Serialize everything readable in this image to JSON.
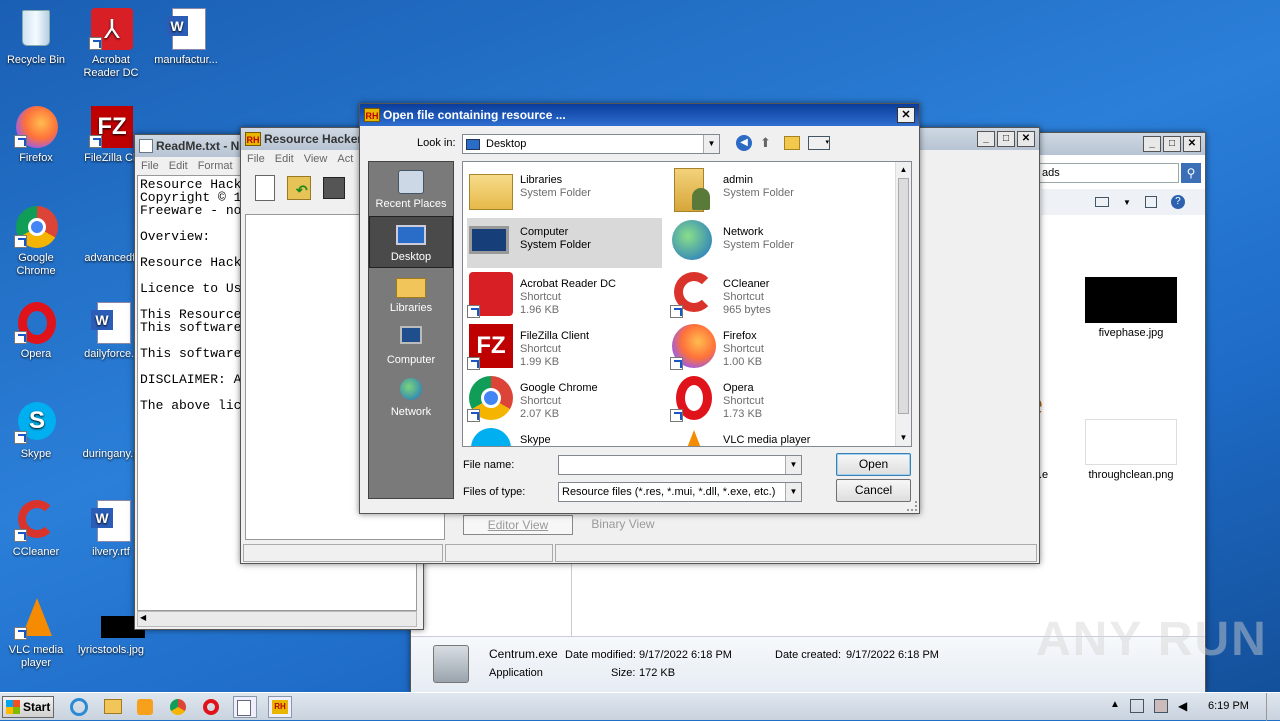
{
  "desktop_icons": [
    {
      "name": "recycle-bin",
      "label": "Recycle Bin"
    },
    {
      "name": "acrobat",
      "label": "Acrobat Reader DC"
    },
    {
      "name": "manufactur",
      "label": "manufactur..."
    },
    {
      "name": "firefox",
      "label": "Firefox"
    },
    {
      "name": "filezilla",
      "label": "FileZilla Cli"
    },
    {
      "name": "chrome",
      "label": "Google Chrome"
    },
    {
      "name": "advancedf",
      "label": "advancedfi"
    },
    {
      "name": "opera",
      "label": "Opera"
    },
    {
      "name": "dailyforce",
      "label": "dailyforce.r"
    },
    {
      "name": "skype",
      "label": "Skype"
    },
    {
      "name": "duringany",
      "label": "duringany.p"
    },
    {
      "name": "ccleaner",
      "label": "CCleaner"
    },
    {
      "name": "ilvery",
      "label": "ilvery.rtf"
    },
    {
      "name": "vlc",
      "label": "VLC media player"
    },
    {
      "name": "lyricstools",
      "label": "lyricstools.jpg"
    }
  ],
  "notepad": {
    "title": "ReadMe.txt - N",
    "menu": [
      "File",
      "Edit",
      "Format"
    ],
    "lines": [
      "Resource Hack",
      "Copyright © 1",
      "Freeware - no",
      "",
      "Overview:",
      "",
      "Resource Hack",
      "",
      "Licence to Us",
      "",
      "This Resource",
      "This software",
      "",
      "This software",
      "",
      "DISCLAIMER: A",
      "",
      "The above lic"
    ]
  },
  "rh": {
    "title": "Resource Hacker",
    "menu": [
      "File",
      "Edit",
      "View",
      "Act"
    ],
    "tab_editor": "Editor View",
    "tab_binary": "Binary View"
  },
  "explorer": {
    "address_tail": "ads",
    "files": [
      {
        "label": "fivephase.jpg"
      },
      {
        "label": "throughclean.png"
      },
      {
        "label": ".e"
      }
    ],
    "details": {
      "name": "Centrum.exe",
      "modified_label": "Date modified:",
      "modified": "9/17/2022 6:18 PM",
      "created_label": "Date created:",
      "created": "9/17/2022 6:18 PM",
      "type": "Application",
      "size_label": "Size:",
      "size": "172 KB"
    }
  },
  "dialog": {
    "title": "Open file containing resource ...",
    "look_in_label": "Look in:",
    "look_in_value": "Desktop",
    "places": [
      {
        "label": "Recent Places",
        "icon": "recent-places-icon"
      },
      {
        "label": "Desktop",
        "icon": "desktop-icon"
      },
      {
        "label": "Libraries",
        "icon": "libraries-icon"
      },
      {
        "label": "Computer",
        "icon": "computer-icon"
      },
      {
        "label": "Network",
        "icon": "network-icon"
      }
    ],
    "items": [
      {
        "name": "Libraries",
        "l2": "System Folder",
        "l3": ""
      },
      {
        "name": "admin",
        "l2": "System Folder",
        "l3": ""
      },
      {
        "name": "Computer",
        "l2": "System Folder",
        "l3": ""
      },
      {
        "name": "Network",
        "l2": "System Folder",
        "l3": ""
      },
      {
        "name": "Acrobat Reader DC",
        "l2": "Shortcut",
        "l3": "1.96 KB"
      },
      {
        "name": "CCleaner",
        "l2": "Shortcut",
        "l3": "965 bytes"
      },
      {
        "name": "FileZilla Client",
        "l2": "Shortcut",
        "l3": "1.99 KB"
      },
      {
        "name": "Firefox",
        "l2": "Shortcut",
        "l3": "1.00 KB"
      },
      {
        "name": "Google Chrome",
        "l2": "Shortcut",
        "l3": "2.07 KB"
      },
      {
        "name": "Opera",
        "l2": "Shortcut",
        "l3": "1.73 KB"
      },
      {
        "name": "Skype",
        "l2": "",
        "l3": ""
      },
      {
        "name": "VLC media player",
        "l2": "",
        "l3": ""
      }
    ],
    "filename_label": "File name:",
    "filename_value": "",
    "filetype_label": "Files of type:",
    "filetype_value": "Resource files (*.res, *.mui, *.dll, *.exe, etc.)",
    "open": "Open",
    "cancel": "Cancel"
  },
  "taskbar": {
    "start": "Start",
    "time": "6:19 PM"
  },
  "watermark": "ANY RUN"
}
